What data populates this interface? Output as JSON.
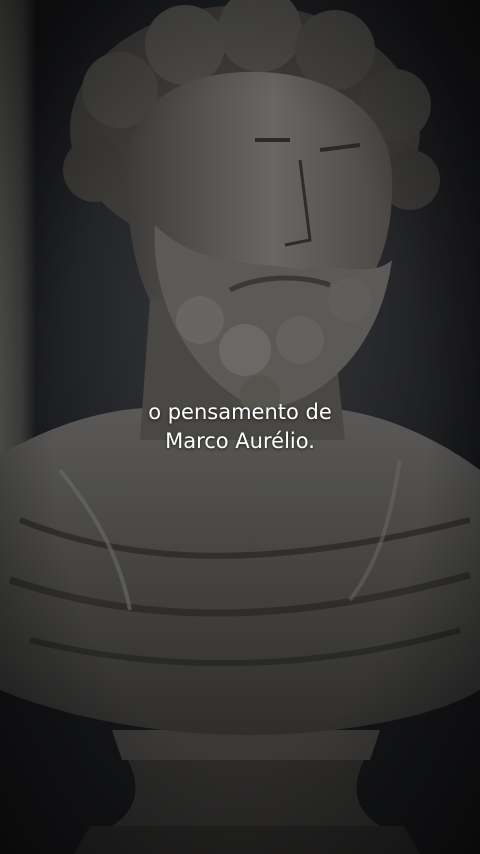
{
  "scene": {
    "subject": "marble-bust-photo",
    "palette": {
      "background": "#1a1b1d",
      "stone": "#5c5b5a",
      "stone_dark": "#3b3a39",
      "caption_text": "#ffffff"
    }
  },
  "caption": {
    "line1": "o pensamento de",
    "line2": "Marco Aurélio."
  }
}
